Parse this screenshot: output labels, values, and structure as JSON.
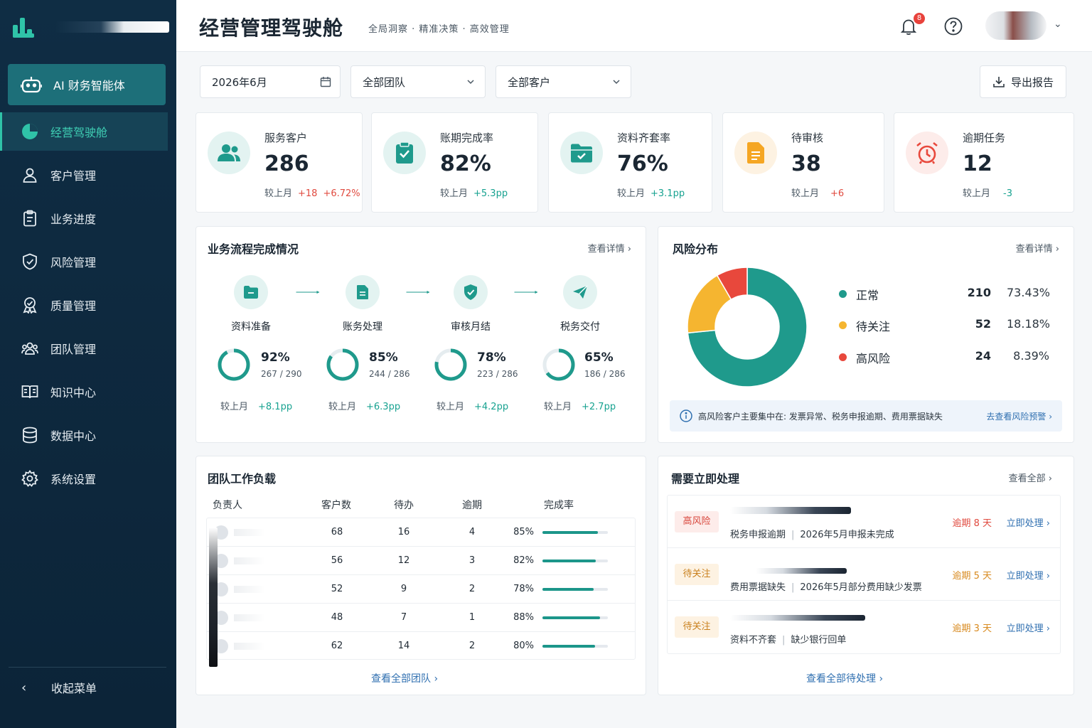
{
  "sidebar": {
    "ai_button": "AI 财务智能体",
    "items": [
      {
        "label": "经营驾驶舱",
        "icon": "pie-chart-icon"
      },
      {
        "label": "客户管理",
        "icon": "user-icon"
      },
      {
        "label": "业务进度",
        "icon": "clipboard-icon"
      },
      {
        "label": "风险管理",
        "icon": "shield-icon"
      },
      {
        "label": "质量管理",
        "icon": "award-icon"
      },
      {
        "label": "团队管理",
        "icon": "team-icon"
      },
      {
        "label": "知识中心",
        "icon": "book-icon"
      },
      {
        "label": "数据中心",
        "icon": "database-icon"
      },
      {
        "label": "系统设置",
        "icon": "gear-icon"
      }
    ],
    "collapse": "收起菜单"
  },
  "header": {
    "title": "经营管理驾驶舱",
    "subtitle": "全局洞察 · 精准决策 · 高效管理",
    "notification_count": "8"
  },
  "filters": {
    "date": "2026年6月",
    "team": "全部团队",
    "customer": "全部客户",
    "export": "导出报告"
  },
  "kpis": [
    {
      "label": "服务客户",
      "value": "286",
      "cmp": "较上月",
      "delta1": "+18",
      "delta2": "+6.72%",
      "color": "#e3f3f1"
    },
    {
      "label": "账期完成率",
      "value": "82%",
      "cmp": "较上月",
      "delta1": "+5.3pp",
      "delta2": "",
      "color": "#e3f3f1"
    },
    {
      "label": "资料齐套率",
      "value": "76%",
      "cmp": "较上月",
      "delta1": "+3.1pp",
      "delta2": "",
      "color": "#e3f3f1"
    },
    {
      "label": "待审核",
      "value": "38",
      "cmp": "较上月",
      "delta1": "+6",
      "delta2": "",
      "color": "#fdf2e2"
    },
    {
      "label": "逾期任务",
      "value": "12",
      "cmp": "较上月",
      "delta1": "-3",
      "delta2": "",
      "color": "#fdecea"
    }
  ],
  "process": {
    "title": "业务流程完成情况",
    "link": "查看详情",
    "steps": [
      {
        "label": "资料准备",
        "pct": "92%",
        "value": 0.92,
        "frac": "267 / 290",
        "cmp": "较上月",
        "delta": "+8.1pp"
      },
      {
        "label": "账务处理",
        "pct": "85%",
        "value": 0.85,
        "frac": "244 / 286",
        "cmp": "较上月",
        "delta": "+6.3pp"
      },
      {
        "label": "审核月结",
        "pct": "78%",
        "value": 0.78,
        "frac": "223 / 286",
        "cmp": "较上月",
        "delta": "+4.2pp"
      },
      {
        "label": "税务交付",
        "pct": "65%",
        "value": 0.65,
        "frac": "186 / 286",
        "cmp": "较上月",
        "delta": "+2.7pp"
      }
    ]
  },
  "risk": {
    "title": "风险分布",
    "link": "查看详情",
    "items": [
      {
        "name": "正常",
        "count": "210",
        "pct": "73.43%",
        "value": 210,
        "color": "#1f9a8c"
      },
      {
        "name": "待关注",
        "count": "52",
        "pct": "18.18%",
        "value": 52,
        "color": "#f5b530"
      },
      {
        "name": "高风险",
        "count": "24",
        "pct": "8.39%",
        "value": 24,
        "color": "#e8483c"
      }
    ],
    "note": "高风险客户主要集中在: 发票异常、税务申报逾期、费用票据缺失",
    "note_link": "去查看风险预警"
  },
  "team": {
    "title": "团队工作负载",
    "headers": [
      "负责人",
      "客户数",
      "待办",
      "逾期",
      "完成率"
    ],
    "rows": [
      {
        "clients": "68",
        "todo": "16",
        "overdue": "4",
        "rate": "85%",
        "value": 0.85
      },
      {
        "clients": "56",
        "todo": "12",
        "overdue": "3",
        "rate": "82%",
        "value": 0.82
      },
      {
        "clients": "52",
        "todo": "9",
        "overdue": "2",
        "rate": "78%",
        "value": 0.78
      },
      {
        "clients": "48",
        "todo": "7",
        "overdue": "1",
        "rate": "88%",
        "value": 0.88
      },
      {
        "clients": "62",
        "todo": "14",
        "overdue": "2",
        "rate": "80%",
        "value": 0.8
      }
    ],
    "footer": "查看全部团队"
  },
  "actions": {
    "title": "需要立即处理",
    "link": "查看全部",
    "items": [
      {
        "tag": "高风险",
        "level": "high",
        "type": "税务申报逾期",
        "detail": "2026年5月申报未完成",
        "due": "逾期 8 天",
        "handle": "立即处理"
      },
      {
        "tag": "待关注",
        "level": "watch",
        "type": "费用票据缺失",
        "detail": "2026年5月部分费用缺少发票",
        "due": "逾期 5 天",
        "handle": "立即处理"
      },
      {
        "tag": "待关注",
        "level": "watch",
        "type": "资料不齐套",
        "detail": "缺少银行回单",
        "due": "逾期 3 天",
        "handle": "立即处理"
      }
    ],
    "footer": "查看全部待处理"
  }
}
